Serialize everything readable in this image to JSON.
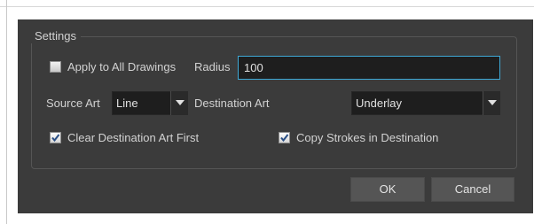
{
  "group": {
    "title": "Settings"
  },
  "apply_all": {
    "label": "Apply to All Drawings",
    "checked": false
  },
  "radius": {
    "label": "Radius",
    "value": "100"
  },
  "source_art": {
    "label": "Source Art",
    "value": "Line"
  },
  "destination_art": {
    "label": "Destination Art",
    "value": "Underlay"
  },
  "clear_destination": {
    "label": "Clear Destination Art First",
    "checked": true
  },
  "copy_strokes": {
    "label": "Copy Strokes in Destination",
    "checked": true
  },
  "buttons": {
    "ok": "OK",
    "cancel": "Cancel"
  },
  "colors": {
    "dialog_bg": "#3b3b3b",
    "field_bg": "#1e1e1e",
    "focus_border": "#3fa9d6",
    "button_bg": "#555555",
    "text": "#d2d2d2"
  }
}
